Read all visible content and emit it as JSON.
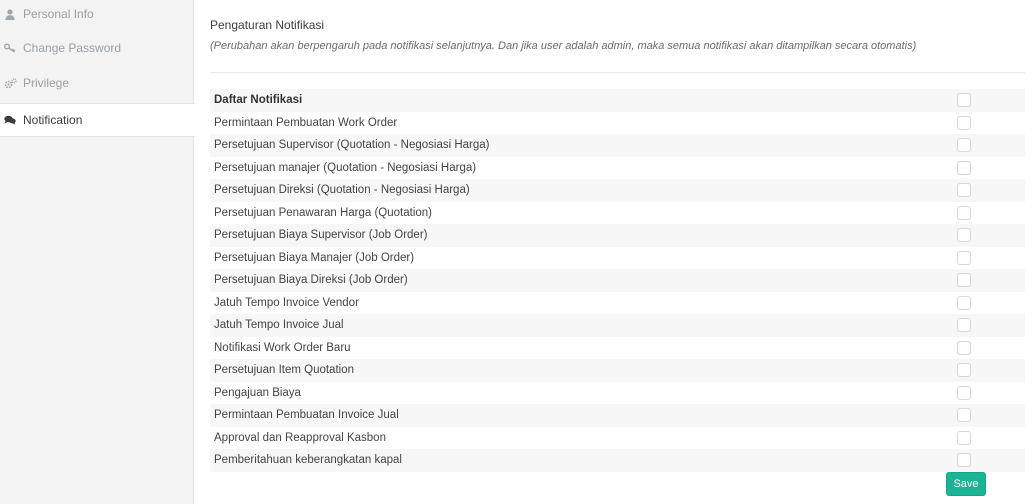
{
  "sidebar": {
    "items": [
      {
        "label": "Personal Info",
        "icon": "user-icon",
        "active": false
      },
      {
        "label": "Change Password",
        "icon": "key-icon",
        "active": false
      },
      {
        "label": "Privilege",
        "icon": "gears-icon",
        "active": false
      },
      {
        "label": "Notification",
        "icon": "comments-icon",
        "active": true
      }
    ]
  },
  "main": {
    "title": "Pengaturan Notifikasi",
    "note": "(Perubahan akan berpengaruh pada notifikasi selanjutnya. Dan jika user adalah admin, maka semua notifikasi akan ditampilkan secara otomatis)",
    "table": {
      "header": "Daftar Notifikasi",
      "rows": [
        "Permintaan Pembuatan Work Order",
        "Persetujuan Supervisor (Quotation - Negosiasi Harga)",
        "Persetujuan manajer (Quotation - Negosiasi Harga)",
        "Persetujuan Direksi (Quotation - Negosiasi Harga)",
        "Persetujuan Penawaran Harga (Quotation)",
        "Persetujuan Biaya Supervisor (Job Order)",
        "Persetujuan Biaya Manajer (Job Order)",
        "Persetujuan Biaya Direksi (Job Order)",
        "Jatuh Tempo Invoice Vendor",
        "Jatuh Tempo Invoice Jual",
        "Notifikasi Work Order Baru",
        "Persetujuan Item Quotation",
        "Pengajuan Biaya",
        "Permintaan Pembuatan Invoice Jual",
        "Approval dan Reapproval Kasbon",
        "Pemberitahuan keberangkatan kapal"
      ]
    },
    "save_label": "Save"
  },
  "colors": {
    "accent": "#1ab394",
    "sidebar_bg": "#f3f3f4",
    "stripe": "#f7f7f7"
  }
}
